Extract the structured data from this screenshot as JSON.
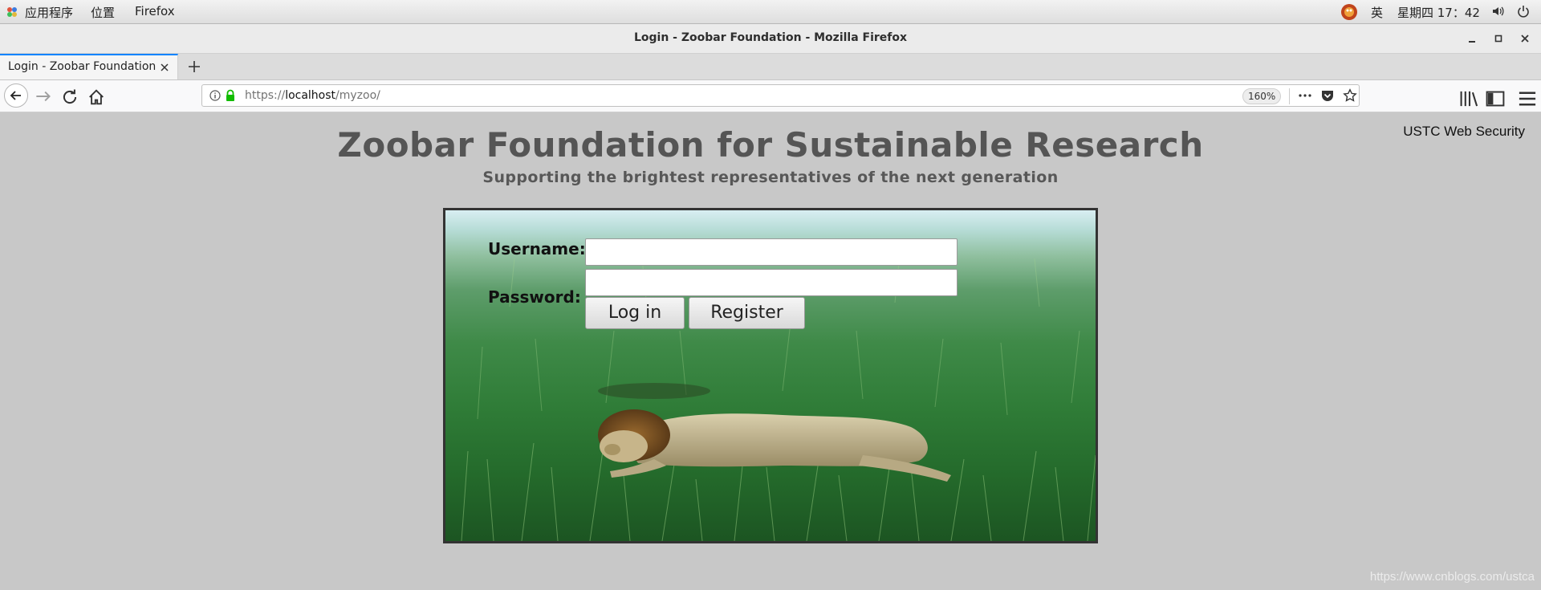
{
  "topbar": {
    "apps_menu": "应用程序",
    "places_menu": "位置",
    "active_app": "Firefox",
    "input_method": "英",
    "clock": "星期四 17：42"
  },
  "window": {
    "title": "Login - Zoobar Foundation - Mozilla Firefox"
  },
  "tab": {
    "label": "Login - Zoobar Foundation"
  },
  "navbar": {
    "url_scheme": "https://",
    "url_host": "localhost",
    "url_path": "/myzoo/",
    "zoom": "160%"
  },
  "page": {
    "title": "Zoobar Foundation for Sustainable Research",
    "subtitle": "Supporting the brightest representatives of the next generation",
    "corner_label": "USTC Web Security",
    "form": {
      "username_label": "Username:",
      "password_label": "Password:",
      "username_value": "",
      "password_value": "",
      "login_label": "Log in",
      "register_label": "Register"
    }
  },
  "watermark": "https://www.cnblogs.com/ustca",
  "colors": {
    "tab_accent": "#0a84ff",
    "page_bg": "#c8c8c8",
    "lock_green": "#12bc00"
  },
  "icons": [
    "apps-icon",
    "user-avatar-icon",
    "volume-icon",
    "power-icon",
    "info-icon",
    "lock-icon",
    "back-icon",
    "forward-icon",
    "reload-icon",
    "home-icon",
    "more-icon",
    "pocket-icon",
    "bookmark-star-icon",
    "library-icon",
    "sidebar-icon",
    "menu-icon",
    "new-tab-icon",
    "close-icon"
  ]
}
